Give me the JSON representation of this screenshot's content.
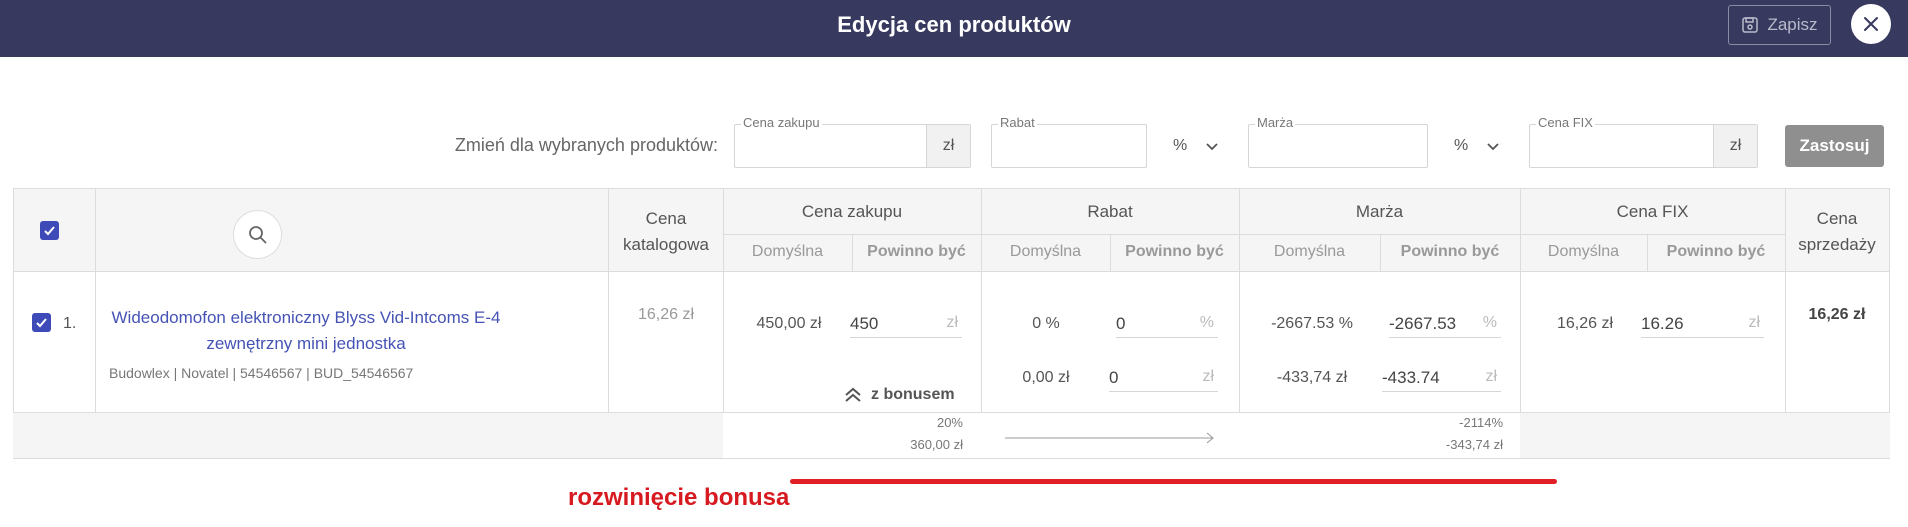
{
  "header": {
    "title": "Edycja cen produktów",
    "save_label": "Zapisz"
  },
  "bulk": {
    "label": "Zmień dla wybranych produktów:",
    "purchase": {
      "label": "Cena zakupu",
      "suffix": "zł"
    },
    "discount": {
      "label": "Rabat",
      "unit": "%"
    },
    "margin": {
      "label": "Marża",
      "unit": "%"
    },
    "fix": {
      "label": "Cena FIX",
      "suffix": "zł"
    },
    "apply_label": "Zastosuj"
  },
  "table": {
    "headers": {
      "catalog": "Cena katalogowa",
      "purchase": "Cena zakupu",
      "discount": "Rabat",
      "margin": "Marża",
      "fix": "Cena FIX",
      "sale": "Cena sprzedaży",
      "default": "Domyślna",
      "should_be": "Powinno być"
    },
    "row": {
      "index": "1.",
      "name": "Wideodomofon elektroniczny Blyss Vid-Intcoms E-4 zewnętrzny mini jednostka",
      "meta": "Budowlex | Novatel | 54546567 | BUD_54546567",
      "catalog_price": "16,26 zł",
      "purchase_default": "450,00 zł",
      "purchase_input": "450",
      "purchase_unit": "zł",
      "discount_pct_default": "0 %",
      "discount_pct_input": "0",
      "discount_pct_unit": "%",
      "discount_amt_default": "0,00 zł",
      "discount_amt_input": "0",
      "discount_amt_unit": "zł",
      "margin_pct_default": "-2667.53 %",
      "margin_pct_input": "-2667.53",
      "margin_pct_unit": "%",
      "margin_amt_default": "-433,74 zł",
      "margin_amt_input": "-433.74",
      "margin_amt_unit": "zł",
      "fix_default": "16,26 zł",
      "fix_input": "16.26",
      "fix_unit": "zł",
      "sale_price": "16,26 zł",
      "bonus_label": "z bonusem"
    },
    "bonus": {
      "pct": "20%",
      "amount": "360,00 zł",
      "margin_pct": "-2114%",
      "margin_amount": "-343,74 zł"
    }
  },
  "annotation": {
    "text": "rozwinięcie bonusa",
    "color": "#d71920"
  },
  "colors": {
    "header_bg": "#373a5e",
    "accent": "#3d4ab8",
    "link": "#4553b5"
  }
}
